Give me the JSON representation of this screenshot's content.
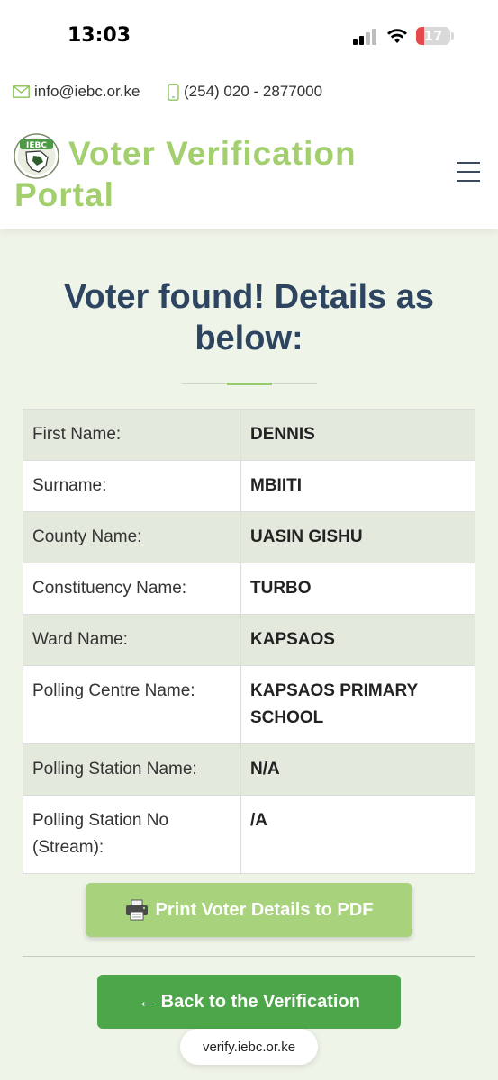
{
  "status_bar": {
    "time": "13:03",
    "battery_level": "17",
    "battery_color": "#e5484d"
  },
  "contact": {
    "email": "info@iebc.or.ke",
    "phone": "(254) 020 - 2877000",
    "email_icon": "envelope-icon",
    "phone_icon": "mobile-phone-icon"
  },
  "header": {
    "logo_text": "IEBC",
    "title_line1": "Voter Verification",
    "title_line2": "Portal",
    "brand_color": "#a3cf6f",
    "menu_icon": "hamburger-menu-icon"
  },
  "main": {
    "heading_line1": "Voter found! Details as",
    "heading_line2": "below:",
    "details": [
      {
        "label": "First Name:",
        "value": "DENNIS"
      },
      {
        "label": "Surname:",
        "value": "MBIITI"
      },
      {
        "label": "County Name:",
        "value": "UASIN GISHU"
      },
      {
        "label": "Constituency Name:",
        "value": "TURBO"
      },
      {
        "label": "Ward Name:",
        "value": "KAPSAOS"
      },
      {
        "label": "Polling Centre Name:",
        "value": "KAPSAOS PRIMARY SCHOOL"
      },
      {
        "label": "Polling Station Name:",
        "value": "N/A"
      },
      {
        "label": "Polling Station No (Stream):",
        "value": "/A"
      }
    ]
  },
  "actions": {
    "print_label": "Print Voter Details to PDF",
    "print_icon": "printer-icon",
    "print_color": "#a8d37c",
    "back_label": "← Back to the Verification",
    "back_color": "#4ea64a"
  },
  "browser": {
    "url": "verify.iebc.or.ke"
  }
}
